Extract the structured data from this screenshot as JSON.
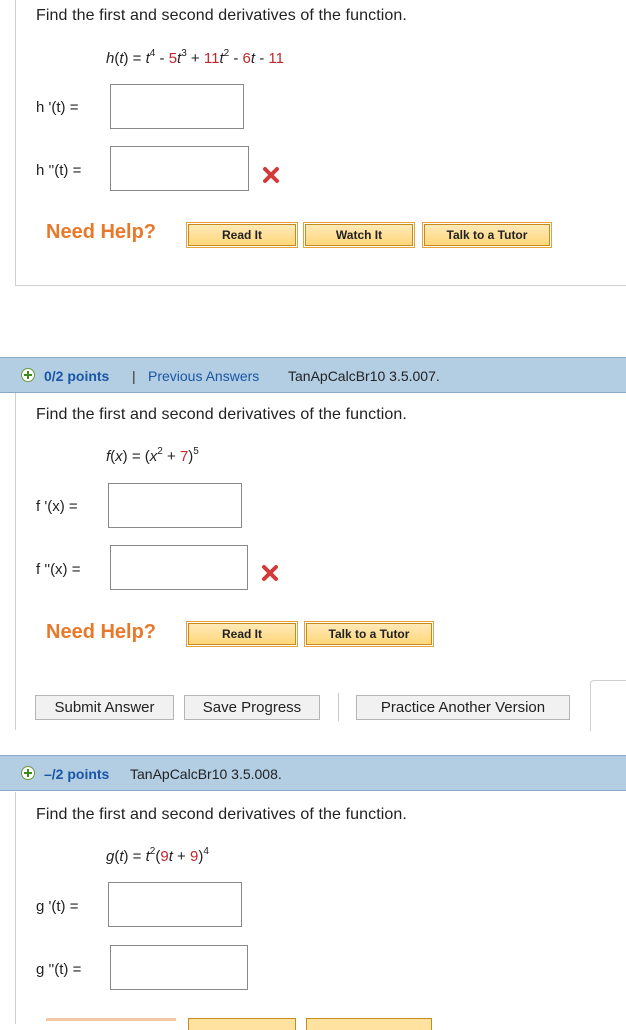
{
  "q1": {
    "prompt": "Find the first and second derivatives of the function.",
    "function": "h(t) = t⁴ - 5t³ + 11t² - 6t - 11",
    "first_label": "h '(t) =",
    "second_label": "h ''(t) =",
    "first_value": "",
    "second_value": "",
    "need_help": "Need Help?",
    "buttons": [
      "Read It",
      "Watch It",
      "Talk to a Tutor"
    ]
  },
  "q2": {
    "points": "0/2 points",
    "separator": "|",
    "previous_answers": "Previous Answers",
    "code": "TanApCalcBr10 3.5.007.",
    "prompt": "Find the first and second derivatives of the function.",
    "function": "f(x) = (x² + 7)⁵",
    "first_label": "f '(x) =",
    "second_label": "f ''(x) =",
    "first_value": "",
    "second_value": "",
    "need_help": "Need Help?",
    "buttons": [
      "Read It",
      "Talk to a Tutor"
    ]
  },
  "actions": {
    "submit": "Submit Answer",
    "save": "Save Progress",
    "practice": "Practice Another Version"
  },
  "q3": {
    "points": "–/2 points",
    "code": "TanApCalcBr10 3.5.008.",
    "prompt": "Find the first and second derivatives of the function.",
    "function": "g(t) = t²(9t + 9)⁴",
    "first_label": "g '(t) =",
    "second_label": "g ''(t) =",
    "first_value": "",
    "second_value": ""
  },
  "colors": {
    "accent_blue": "#1a56a6",
    "header_bar": "#b3cde3",
    "help_orange": "#e8792a",
    "error_red": "#c0272d",
    "coefficient_red": "#c0272d"
  },
  "icons": [
    "incorrect-x-icon",
    "expand-plus-icon"
  ]
}
